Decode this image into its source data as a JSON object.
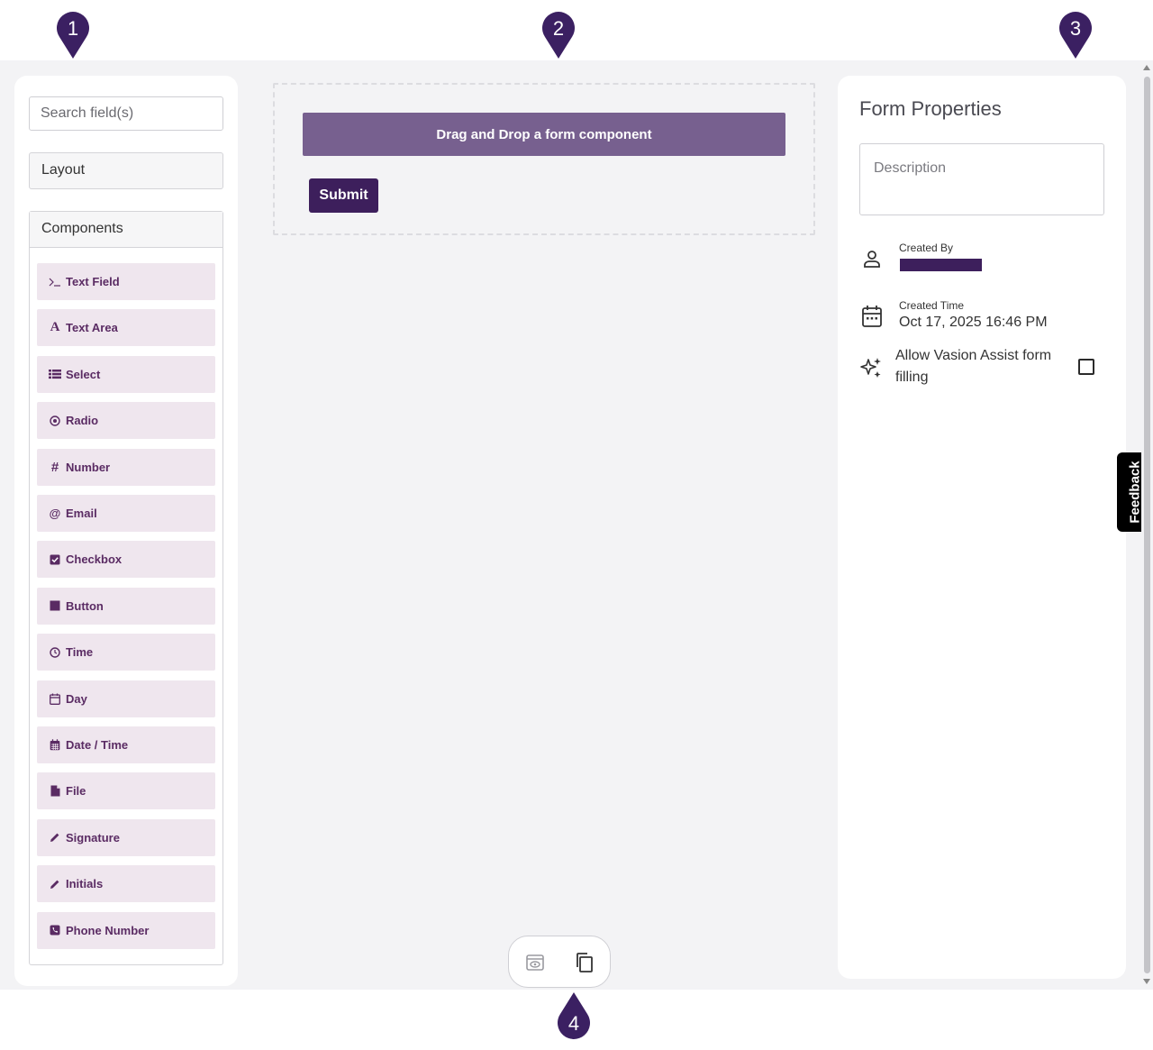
{
  "markers": [
    "1",
    "2",
    "3",
    "4"
  ],
  "left": {
    "search_placeholder": "Search field(s)",
    "layout_label": "Layout",
    "components_label": "Components",
    "components": [
      {
        "label": "Text Field",
        "icon": "terminal-icon"
      },
      {
        "label": "Text Area",
        "icon": "font-icon"
      },
      {
        "label": "Select",
        "icon": "list-icon"
      },
      {
        "label": "Radio",
        "icon": "radio-icon"
      },
      {
        "label": "Number",
        "icon": "hash-icon"
      },
      {
        "label": "Email",
        "icon": "at-icon"
      },
      {
        "label": "Checkbox",
        "icon": "checkbox-icon"
      },
      {
        "label": "Button",
        "icon": "stop-icon"
      },
      {
        "label": "Time",
        "icon": "clock-icon"
      },
      {
        "label": "Day",
        "icon": "calendar-icon"
      },
      {
        "label": "Date / Time",
        "icon": "calendar-grid-icon"
      },
      {
        "label": "File",
        "icon": "file-icon"
      },
      {
        "label": "Signature",
        "icon": "pencil-icon"
      },
      {
        "label": "Initials",
        "icon": "pencil-icon"
      },
      {
        "label": "Phone Number",
        "icon": "phone-icon"
      }
    ]
  },
  "center": {
    "drag_text": "Drag and Drop a form component",
    "submit_label": "Submit"
  },
  "right": {
    "title": "Form Properties",
    "description_placeholder": "Description",
    "created_by_label": "Created By",
    "created_time_label": "Created Time",
    "created_time_value": "Oct 17, 2025 16:46 PM",
    "assist_label": "Allow Vasion Assist form filling",
    "assist_checked": false
  },
  "feedback_label": "Feedback",
  "colors": {
    "brand": "#3d1f5c",
    "banner": "#77608f",
    "component_bg": "#efe6ee",
    "component_text": "#5a2b63"
  }
}
